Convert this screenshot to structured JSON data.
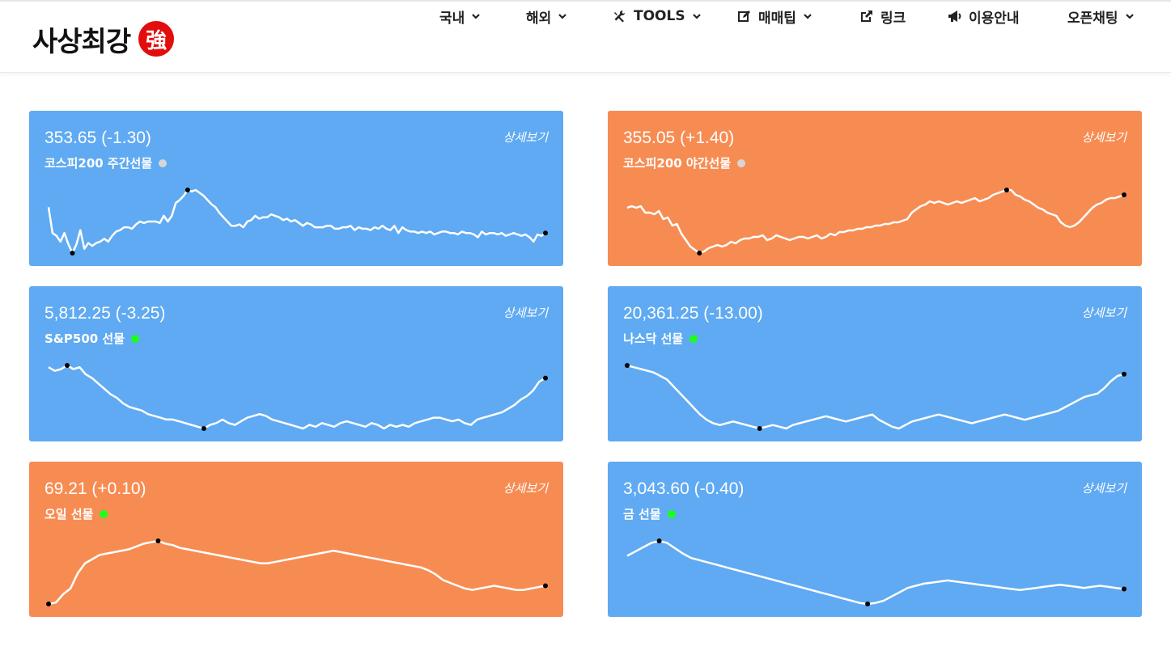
{
  "brand": {
    "name": "사상최강",
    "seal": "強"
  },
  "nav": [
    {
      "label": "국내",
      "icon": "",
      "chevron": true
    },
    {
      "label": "해외",
      "icon": "",
      "chevron": true
    },
    {
      "label": "TOOLS",
      "icon": "tools-icon",
      "chevron": true
    },
    {
      "label": "매매팁",
      "icon": "edit-icon",
      "chevron": true
    },
    {
      "label": "링크",
      "icon": "external-link-icon",
      "chevron": false
    },
    {
      "label": "이용안내",
      "icon": "megaphone-icon",
      "chevron": false
    },
    {
      "label": "오픈채팅",
      "icon": "",
      "chevron": true
    }
  ],
  "colors": {
    "blue": "#5faaf2",
    "orange": "#f78c53",
    "dot_gray": "#d6d6d6",
    "dot_green": "#1cff1c"
  },
  "more_label": "상세보기",
  "cards": [
    {
      "value": "353.65 (-1.30)",
      "label": "코스피200 주간선물",
      "color": "blue",
      "status": "gray",
      "spark": [
        62,
        44,
        42,
        38,
        44,
        36,
        30,
        36,
        46,
        33,
        37,
        35,
        37,
        38,
        40,
        38,
        42,
        45,
        46,
        48,
        48,
        47,
        50,
        52,
        51,
        52,
        52,
        52,
        51,
        56,
        52,
        56,
        65,
        67,
        70,
        74,
        73,
        74,
        72,
        70,
        67,
        64,
        62,
        58,
        55,
        52,
        49,
        49,
        50,
        48,
        52,
        53,
        56,
        54,
        55,
        55,
        57,
        56,
        55,
        53,
        54,
        52,
        53,
        51,
        49,
        51,
        50,
        48,
        48,
        48,
        49,
        49,
        47,
        47,
        48,
        48,
        49,
        46,
        48,
        47,
        47,
        46,
        48,
        47,
        49,
        47,
        46,
        49,
        44,
        48,
        46,
        45,
        45,
        44,
        45,
        44,
        45,
        43,
        44,
        45,
        45,
        44,
        44,
        43,
        45,
        44,
        44,
        43,
        41,
        45,
        43,
        44,
        44,
        43,
        44,
        42,
        43,
        44,
        43,
        42,
        43,
        41,
        38,
        43,
        42,
        44
      ]
    },
    {
      "value": "355.05 (+1.40)",
      "label": "코스피200 야간선물",
      "color": "orange",
      "status": "gray",
      "spark": [
        53,
        54,
        53,
        54,
        50,
        50,
        49,
        51,
        46,
        47,
        42,
        43,
        37,
        33,
        29,
        27,
        25,
        26,
        28,
        29,
        30,
        29,
        30,
        32,
        31,
        33,
        34,
        34,
        35,
        35,
        36,
        33,
        34,
        36,
        35,
        34,
        33,
        34,
        35,
        35,
        34,
        35,
        36,
        34,
        35,
        37,
        36,
        38,
        38,
        39,
        39,
        40,
        40,
        41,
        41,
        42,
        42,
        43,
        43,
        44,
        44,
        45,
        46,
        50,
        52,
        54,
        55,
        57,
        56,
        57,
        56,
        55,
        56,
        57,
        56,
        57,
        58,
        59,
        57,
        58,
        59,
        61,
        62,
        63,
        64,
        64,
        61,
        60,
        58,
        57,
        55,
        53,
        52,
        50,
        49,
        48,
        44,
        42,
        41,
        42,
        44,
        47,
        50,
        53,
        55,
        56,
        58,
        59,
        59,
        60,
        61
      ]
    },
    {
      "value": "5,812.25 (-3.25)",
      "label": "S&P500 선물",
      "color": "blue",
      "status": "green",
      "spark": [
        84,
        82,
        83,
        85,
        83,
        84,
        80,
        78,
        75,
        72,
        69,
        67,
        64,
        62,
        61,
        60,
        58,
        57,
        56,
        55,
        55,
        54,
        53,
        52,
        51,
        50,
        52,
        53,
        55,
        53,
        52,
        54,
        56,
        57,
        58,
        57,
        55,
        54,
        53,
        52,
        51,
        50,
        52,
        51,
        53,
        52,
        51,
        53,
        54,
        53,
        52,
        51,
        53,
        52,
        50,
        52,
        51,
        52,
        51,
        53,
        54,
        55,
        56,
        56,
        55,
        54,
        55,
        53,
        52,
        55,
        56,
        57,
        58,
        59,
        61,
        63,
        66,
        68,
        71,
        76,
        78
      ]
    },
    {
      "value": "20,361.25 (-13.00)",
      "label": "나스닥 선물",
      "color": "blue",
      "status": "green",
      "spark": [
        86,
        85,
        84,
        83,
        82,
        80,
        78,
        74,
        70,
        66,
        62,
        58,
        55,
        53,
        52,
        53,
        54,
        53,
        52,
        51,
        50,
        51,
        52,
        51,
        50,
        52,
        53,
        54,
        55,
        56,
        57,
        56,
        55,
        54,
        55,
        56,
        57,
        58,
        55,
        53,
        51,
        50,
        52,
        54,
        55,
        56,
        57,
        58,
        57,
        56,
        55,
        54,
        53,
        54,
        55,
        56,
        57,
        58,
        57,
        56,
        55,
        56,
        57,
        58,
        59,
        60,
        62,
        64,
        66,
        68,
        69,
        70,
        73,
        77,
        80,
        81
      ]
    },
    {
      "value": "69.21 (+0.10)",
      "label": "오일 선물",
      "color": "orange",
      "status": "green",
      "spark": [
        23,
        24,
        30,
        34,
        45,
        52,
        55,
        58,
        59,
        60,
        61,
        62,
        64,
        66,
        67,
        68,
        66,
        65,
        63,
        62,
        61,
        60,
        59,
        58,
        57,
        56,
        55,
        54,
        53,
        52,
        52,
        53,
        54,
        55,
        56,
        57,
        58,
        59,
        60,
        61,
        60,
        59,
        58,
        57,
        56,
        55,
        54,
        53,
        52,
        51,
        50,
        49,
        47,
        44,
        40,
        38,
        36,
        34,
        33,
        34,
        35,
        36,
        35,
        34,
        33,
        33,
        34,
        35,
        36
      ]
    },
    {
      "value": "3,043.60 (-0.40)",
      "label": "금 선물",
      "color": "blue",
      "status": "green",
      "spark": [
        78,
        82,
        86,
        90,
        92,
        90,
        85,
        80,
        76,
        74,
        72,
        70,
        68,
        66,
        64,
        62,
        60,
        58,
        56,
        54,
        52,
        50,
        48,
        46,
        44,
        42,
        40,
        38,
        36,
        34,
        33,
        34,
        36,
        40,
        44,
        48,
        50,
        52,
        53,
        54,
        55,
        54,
        53,
        52,
        51,
        50,
        49,
        48,
        47,
        46,
        47,
        48,
        49,
        50,
        51,
        50,
        49,
        48,
        49,
        50,
        49,
        48,
        47
      ]
    }
  ]
}
